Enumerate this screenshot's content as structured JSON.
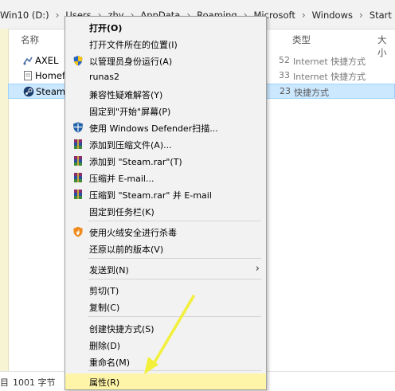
{
  "address": {
    "crumbs": [
      "Win10 (D:)",
      "Users",
      "zhy",
      "AppData",
      "Roaming",
      "Microsoft",
      "Windows",
      "Start Me"
    ]
  },
  "columns": {
    "name": "名称",
    "type": "类型",
    "size": "大小"
  },
  "files": [
    {
      "name": "AXEL",
      "num": "52",
      "type": "Internet 快捷方式",
      "icon": "internet-shortcut-icon"
    },
    {
      "name": "Homefi",
      "num": "33",
      "type": "Internet 快捷方式",
      "icon": "document-icon"
    },
    {
      "name": "Steam",
      "num": "23",
      "type": "快捷方式",
      "icon": "steam-icon"
    }
  ],
  "status": {
    "left": "目",
    "size": "1001 字节"
  },
  "menu": {
    "open": "打开(O)",
    "open_location": "打开文件所在的位置(I)",
    "run_as_admin": "以管理员身份运行(A)",
    "runas2": "runas2",
    "compat": "兼容性疑难解答(Y)",
    "pin_start": "固定到\"开始\"屏幕(P)",
    "defender": "使用 Windows Defender扫描...",
    "add_archive": "添加到压缩文件(A)...",
    "add_steam_rar": "添加到 \"Steam.rar\"(T)",
    "compress_email": "压缩并 E-mail...",
    "compress_steam_email": "压缩到 \"Steam.rar\" 并 E-mail",
    "pin_taskbar": "固定到任务栏(K)",
    "huorong": "使用火绒安全进行杀毒",
    "restore": "还原以前的版本(V)",
    "send_to": "发送到(N)",
    "cut": "剪切(T)",
    "copy": "复制(C)",
    "create_shortcut": "创建快捷方式(S)",
    "delete": "删除(D)",
    "rename": "重命名(M)",
    "properties": "属性(R)"
  },
  "colors": {
    "highlight": "#fff5a8",
    "selection": "#cce8ff",
    "annotation_arrow": "#f2f03a"
  }
}
